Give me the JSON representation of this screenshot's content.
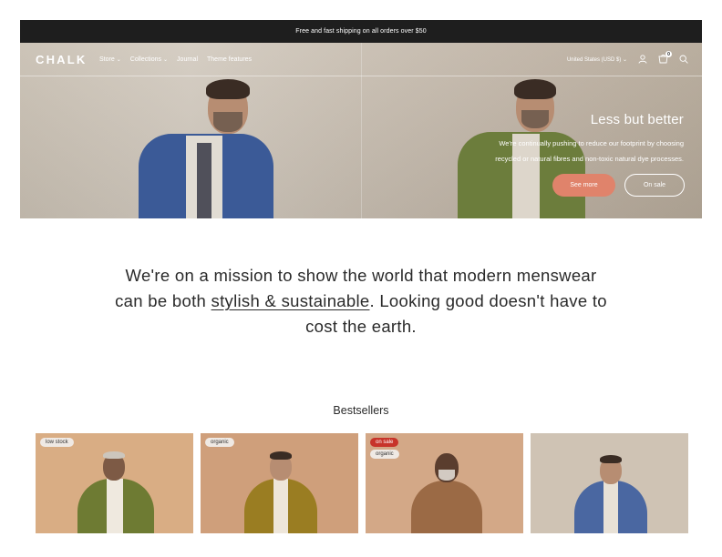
{
  "announcement": "Free and fast shipping on all orders over $50",
  "header": {
    "logo": "CHALK",
    "menu": [
      "Store",
      "Collections",
      "Journal",
      "Theme features"
    ],
    "currency": "United States (USD $)",
    "cart_count": "0",
    "icons": [
      "account-icon",
      "cart-icon",
      "search-icon"
    ]
  },
  "hero": {
    "title": "Less but better",
    "subtitle": "We're continually pushing to reduce our footprint by choosing recycled or natural fibres and non-toxic natural dye processes.",
    "primary_button": "See more",
    "secondary_button": "On sale"
  },
  "mission": {
    "part1": "We're on a mission to show the world that modern menswear can be both ",
    "link": "stylish & sustainable",
    "part2": ". Looking good doesn't have to cost the earth."
  },
  "bestsellers": {
    "heading": "Bestsellers",
    "cards": [
      {
        "badges": [
          "low stock"
        ]
      },
      {
        "badges": [
          "organic"
        ]
      },
      {
        "badges": [
          "on sale",
          "organic"
        ]
      },
      {
        "badges": []
      }
    ]
  },
  "colors": {
    "announcement_bg": "#1e1e1e",
    "accent_button": "#e0836b",
    "sale_badge": "#c7342a"
  }
}
